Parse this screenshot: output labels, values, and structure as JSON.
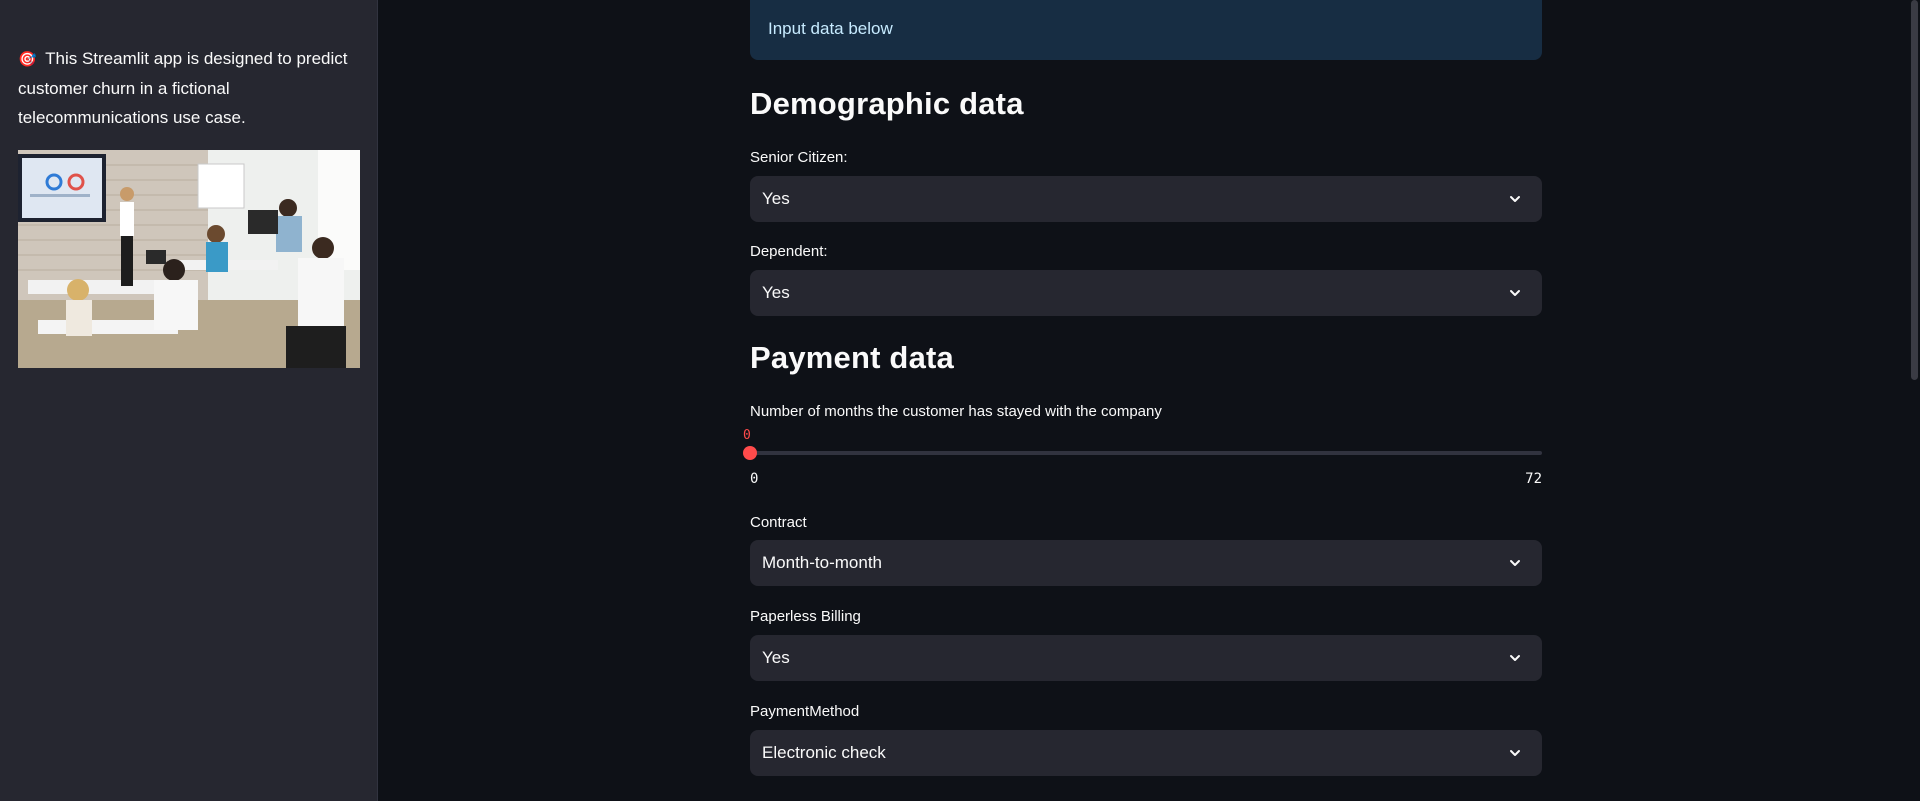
{
  "sidebar": {
    "emoji": "🎯",
    "description": "This Streamlit app is designed to predict customer churn in a fictional telecommunications use case.",
    "image_alt": "classroom-presentation-photo"
  },
  "main": {
    "info": "Input data below",
    "demographic_title": "Demographic data",
    "senior_label": "Senior Citizen:",
    "senior_value": "Yes",
    "dependent_label": "Dependent:",
    "dependent_value": "Yes",
    "payment_title": "Payment data",
    "tenure_label": "Number of months the customer has stayed with the company",
    "tenure_value": "0",
    "tenure_min": "0",
    "tenure_max": "72",
    "contract_label": "Contract",
    "contract_value": "Month-to-month",
    "paperless_label": "Paperless Billing",
    "paperless_value": "Yes",
    "paymethod_label": "PaymentMethod",
    "paymethod_value": "Electronic check"
  },
  "colors": {
    "accent": "#ff4b4b",
    "background": "#0e1117",
    "sidebar": "#262730",
    "info_bg": "#172d43"
  }
}
